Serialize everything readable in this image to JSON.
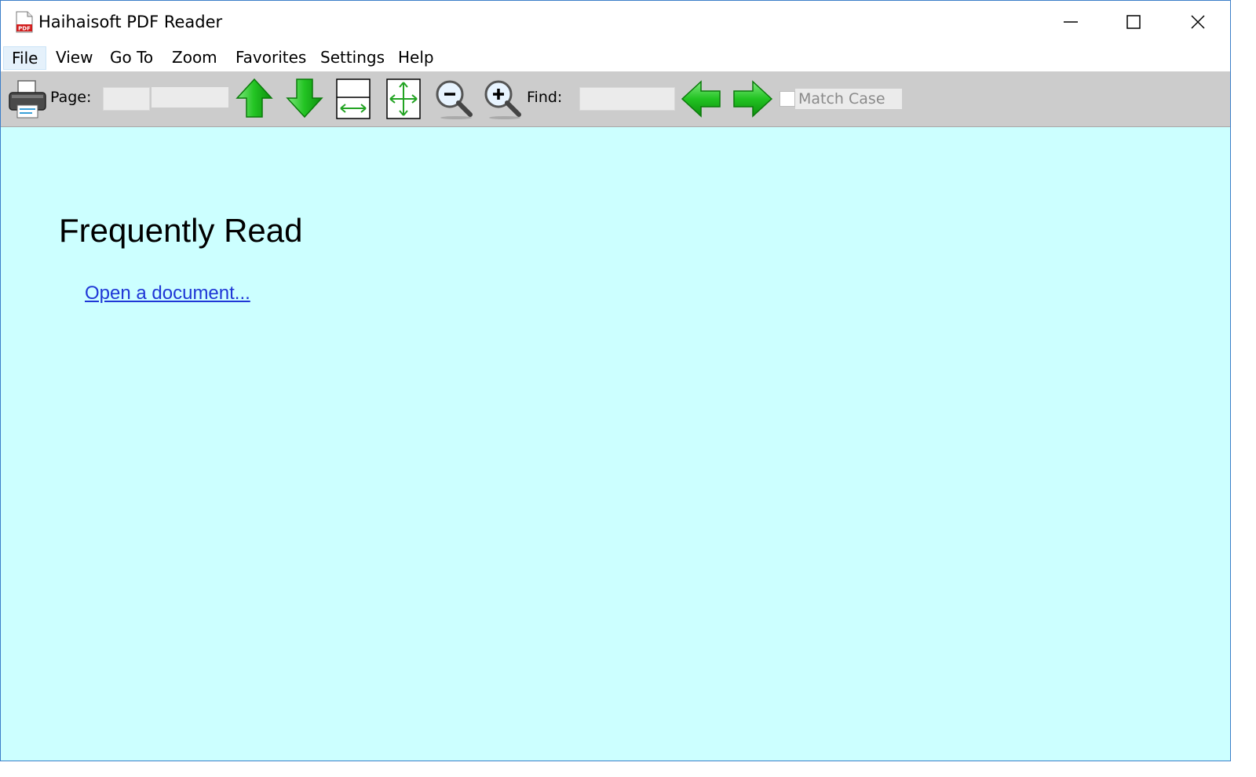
{
  "window": {
    "title": "Haihaisoft PDF Reader",
    "app_icon": "pdf-file-icon",
    "controls": [
      "minimize-icon",
      "maximize-icon",
      "close-icon"
    ]
  },
  "menu": {
    "items": [
      "File",
      "View",
      "Go To",
      "Zoom",
      "Favorites",
      "Settings",
      "Help"
    ]
  },
  "toolbar": {
    "page_label": "Page:",
    "page_value": "",
    "page_total": "",
    "find_label": "Find:",
    "find_value": "",
    "match_case_label": "Match Case",
    "match_case_checked": false,
    "icons": [
      "printer-icon",
      "previous-page-icon",
      "next-page-icon",
      "fit-width-icon",
      "fit-page-icon",
      "zoom-out-icon",
      "zoom-in-icon",
      "find-previous-icon",
      "find-next-icon"
    ]
  },
  "content": {
    "heading": "Frequently Read",
    "open_link": "Open a document..."
  },
  "colors": {
    "content_bg": "#ccffff",
    "toolbar_bg": "#cccccc",
    "link": "#1f37d6",
    "arrow_green": "#22c322",
    "window_border": "#3c7fc9"
  }
}
